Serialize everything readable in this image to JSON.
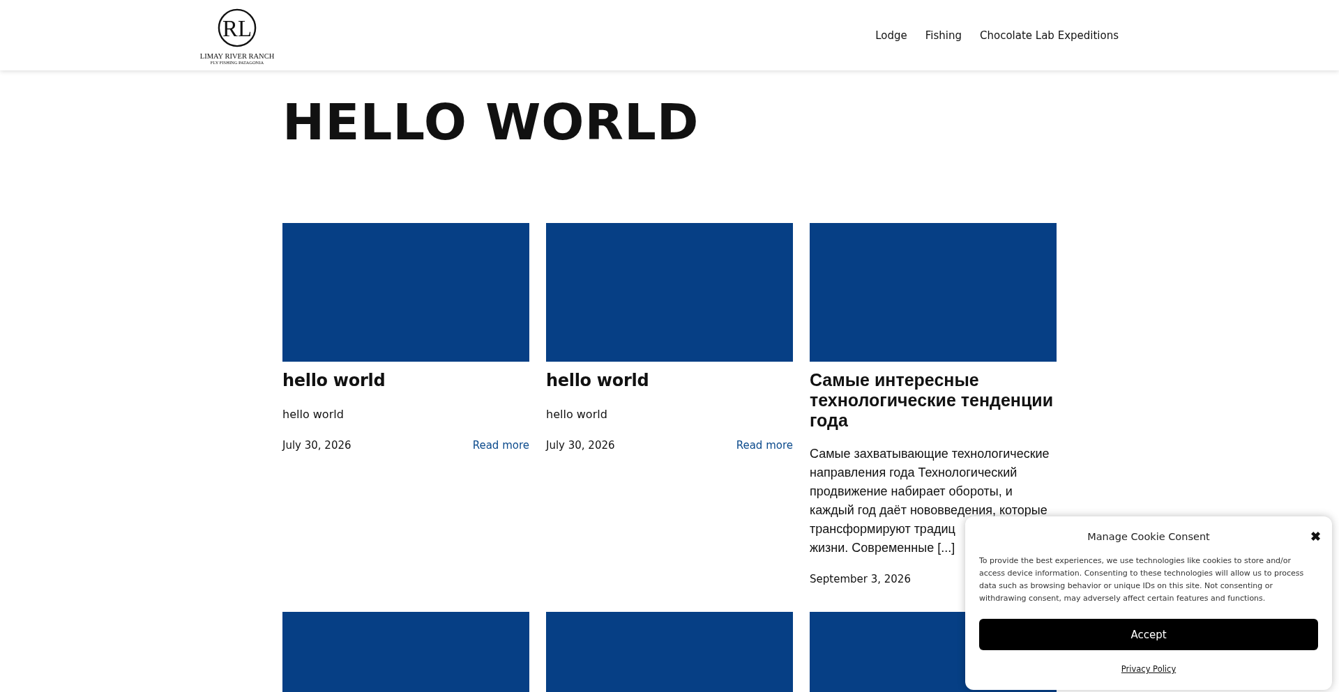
{
  "header": {
    "logo": {
      "monogram": "RL",
      "name": "LIMAY RIVER RANCH",
      "tagline": "FLY FISHING PATAGONIA"
    },
    "nav": [
      "Lodge",
      "Fishing",
      "Chocolate Lab Expeditions"
    ]
  },
  "page_title": "HELLO WORLD",
  "posts": [
    {
      "kind": "article",
      "title": "hello world",
      "excerpt_lines": [
        "hello world"
      ],
      "date": "July 30, 2026",
      "read_more": "Read more"
    },
    {
      "kind": "article",
      "title": "hello world",
      "excerpt_lines": [
        "hello world"
      ],
      "date": "July 30, 2026",
      "read_more": "Read more"
    },
    {
      "title": "Самые интересные технологические тенденции года",
      "excerpt_lines": [
        "Самые захватывающие технологические",
        "направления года Технологический",
        "продвижение набирает обороты, и",
        "каждый год даёт нововведения, которые",
        "трансформируют традиц",
        "жизни. Современные [...]"
      ],
      "date": "September 3, 2026",
      "kind": "article_long"
    },
    {
      "kind": "image"
    },
    {
      "kind": "image"
    },
    {
      "kind": "image"
    }
  ],
  "cookie_dialog": {
    "title": "Manage Cookie Consent",
    "close": "✖",
    "text": "To provide the best experiences, we use technologies like cookies to store and/or access device information. Consenting to these technologies will allow us to process data such as browsing behavior or unique IDs on this site. Not consenting or withdrawing consent, may adversely affect certain features and functions.",
    "accept": "Accept",
    "privacy": "Privacy Policy"
  }
}
